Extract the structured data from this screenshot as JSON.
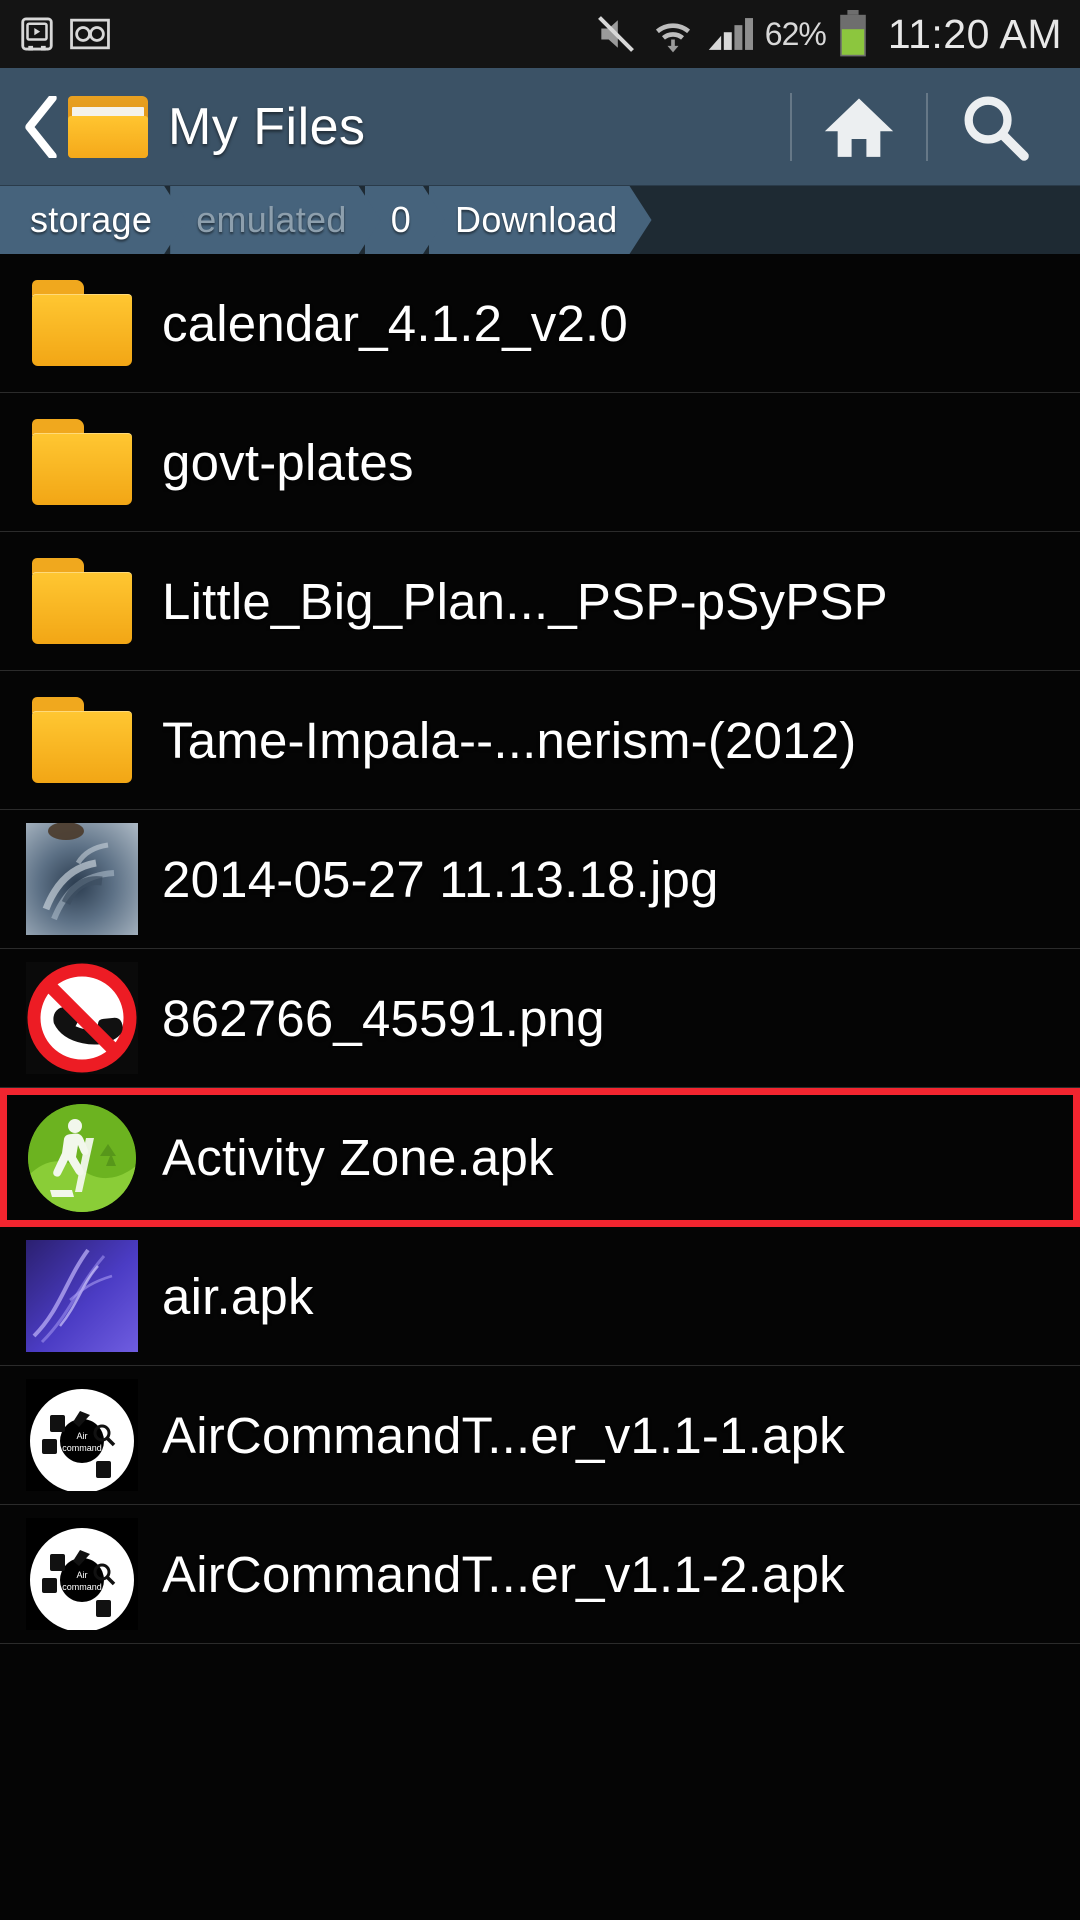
{
  "statusbar": {
    "icons_left": [
      "media-player-icon",
      "voicemail-icon"
    ],
    "icons_right": [
      "mute-icon",
      "wifi-icon",
      "signal-bars-icon",
      "battery-icon"
    ],
    "battery_percent": "62%",
    "clock": "11:20 AM"
  },
  "header": {
    "back_icon": "back-chevron-icon",
    "folder_icon": "folder-icon",
    "title": "My Files",
    "home_icon": "home-icon",
    "search_icon": "search-icon"
  },
  "breadcrumb": {
    "items": [
      {
        "label": "storage",
        "dim": false
      },
      {
        "label": "emulated",
        "dim": true
      },
      {
        "label": "0",
        "dim": false
      },
      {
        "label": "Download",
        "dim": false
      }
    ]
  },
  "files": [
    {
      "name": "calendar_4.1.2_v2.0",
      "icon": "folder-icon",
      "type": "folder",
      "highlight": false
    },
    {
      "name": "govt-plates",
      "icon": "folder-icon",
      "type": "folder",
      "highlight": false
    },
    {
      "name": "Little_Big_Plan..._PSP-pSyPSP",
      "icon": "folder-icon",
      "type": "folder",
      "highlight": false
    },
    {
      "name": "Tame-Impala--...nerism-(2012)",
      "icon": "folder-icon",
      "type": "folder",
      "highlight": false
    },
    {
      "name": "2014-05-27 11.13.18.jpg",
      "icon": "photo-thumbnail",
      "type": "image",
      "highlight": false
    },
    {
      "name": "862766_45591.png",
      "icon": "no-phone-icon",
      "type": "image",
      "highlight": false
    },
    {
      "name": "Activity Zone.apk",
      "icon": "activity-zone-app-icon",
      "type": "apk",
      "highlight": true
    },
    {
      "name": "air.apk",
      "icon": "air-app-icon",
      "type": "apk",
      "highlight": false
    },
    {
      "name": "AirCommandT...er_v1.1-1.apk",
      "icon": "air-command-icon",
      "type": "apk",
      "highlight": false
    },
    {
      "name": "AirCommandT...er_v1.1-2.apk",
      "icon": "air-command-icon",
      "type": "apk",
      "highlight": false
    }
  ],
  "colors": {
    "header_bg": "#3b5266",
    "crumb_bg": "#46637c",
    "crumb_bar_bg": "#1e2a33",
    "highlight_border": "#f2252f",
    "folder_yellow": "#ffc530",
    "battery_green": "#8cc63e"
  }
}
